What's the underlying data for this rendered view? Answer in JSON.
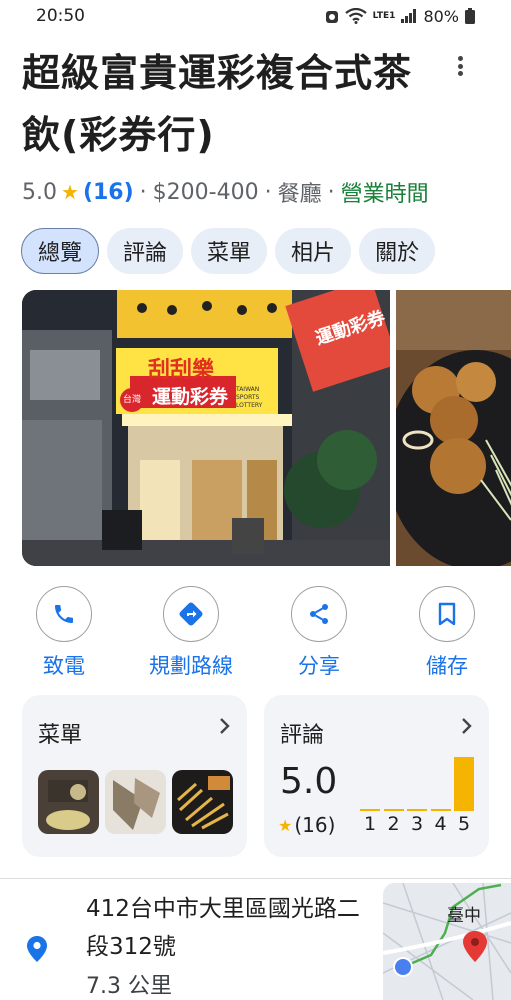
{
  "status_bar": {
    "time": "20:50",
    "battery": "80%",
    "network_label": "LTE1"
  },
  "place": {
    "name": "超級富貴運彩複合式茶飲(彩券行)",
    "rating": "5.0",
    "review_count": "(16)",
    "price": "$200-400",
    "category": "餐廳",
    "hours_link": "營業時間",
    "separator": "·"
  },
  "tabs": [
    {
      "label": "總覽",
      "active": true
    },
    {
      "label": "評論",
      "active": false
    },
    {
      "label": "菜單",
      "active": false
    },
    {
      "label": "相片",
      "active": false
    },
    {
      "label": "關於",
      "active": false
    }
  ],
  "photo": {
    "sign_top": "刮刮樂",
    "sign_main": "運動彩券",
    "sign_en": "TAIWAN SPORTS LOTTERY",
    "sign_side": "運動彩券",
    "sign_logo": "台灣"
  },
  "actions": [
    {
      "label": "致電",
      "icon": "phone-icon"
    },
    {
      "label": "規劃路線",
      "icon": "directions-icon"
    },
    {
      "label": "分享",
      "icon": "share-icon"
    },
    {
      "label": "儲存",
      "icon": "bookmark-icon"
    }
  ],
  "menu_card": {
    "title": "菜單"
  },
  "reviews_card": {
    "title": "評論",
    "score": "5.0",
    "count": "(16)",
    "distribution": [
      {
        "stars": "1",
        "share": 0
      },
      {
        "stars": "2",
        "share": 0
      },
      {
        "stars": "3",
        "share": 0
      },
      {
        "stars": "4",
        "share": 0
      },
      {
        "stars": "5",
        "share": 1
      }
    ]
  },
  "location": {
    "address": "412台中市大里區國光路二段312號",
    "distance": "7.3 公里",
    "map_label": "臺中"
  },
  "colors": {
    "accent": "#1a73e8",
    "open": "#188038",
    "star": "#f4b400",
    "tab_bg": "#e8eef8",
    "tab_active_bg": "#d3e3fd"
  }
}
